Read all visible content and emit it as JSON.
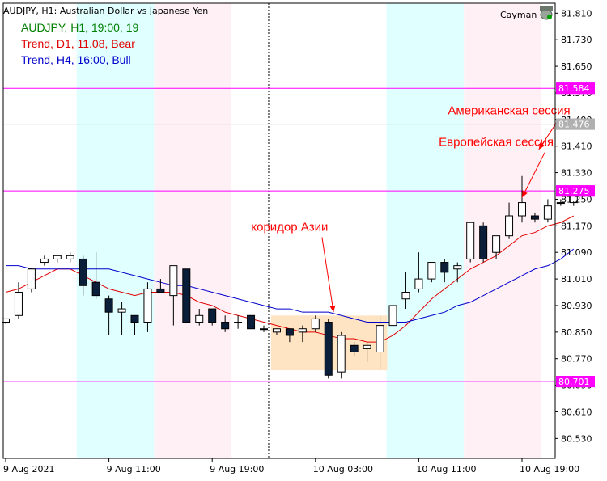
{
  "header": {
    "symbol_line": "AUDJPY, H1:  Australian Dollar vs Japanese Yen",
    "info": [
      {
        "text": "AUDJPY, H1, 19:00, 19",
        "color": "#008000"
      },
      {
        "text": "Trend, D1, 11.08, Bear",
        "color": "#e00000"
      },
      {
        "text": "Trend, H4, 16:00, Bull",
        "color": "#0000cc"
      }
    ],
    "account_label": "Cayman",
    "account_icon": "trader-hat-icon"
  },
  "chart_data": {
    "type": "candlestick",
    "timeframe": "H1",
    "symbol": "AUDJPY",
    "ylim": [
      80.47,
      81.84
    ],
    "y_ticks": [
      "81.810",
      "81.730",
      "81.650",
      "81.570",
      "81.490",
      "81.410",
      "81.330",
      "81.250",
      "81.170",
      "81.090",
      "81.010",
      "80.930",
      "80.850",
      "80.770",
      "80.690",
      "80.610",
      "80.530"
    ],
    "x_tick_labels": [
      {
        "label": "9 Aug 2021",
        "index": 0
      },
      {
        "label": "9 Aug 11:00",
        "index": 8
      },
      {
        "label": "9 Aug 19:00",
        "index": 16
      },
      {
        "label": "10 Aug 03:00",
        "index": 24
      },
      {
        "label": "10 Aug 11:00",
        "index": 32
      },
      {
        "label": "10 Aug 19:00",
        "index": 40
      }
    ],
    "price_levels": [
      {
        "value": 81.584,
        "label": "81.584",
        "color": "#ff00ff"
      },
      {
        "value": 81.476,
        "label": "81.476",
        "color": "#b0b0b0"
      },
      {
        "value": 81.275,
        "label": "81.275",
        "color": "#ff00ff"
      },
      {
        "value": 80.701,
        "label": "80.701",
        "color": "#ff00ff"
      }
    ],
    "sessions": [
      {
        "type": "asia",
        "from": 6,
        "to": 12,
        "color": "#e0ffff"
      },
      {
        "type": "europe",
        "from": 12,
        "to": 18,
        "color": "#fff0f5"
      },
      {
        "type": "asia",
        "from": 30,
        "to": 36,
        "color": "#e0ffff"
      },
      {
        "type": "europe",
        "from": 36,
        "to": 42,
        "color": "#fff0f5"
      }
    ],
    "asia_box": {
      "from": 21,
      "to": 30,
      "low": 80.735,
      "high": 80.9,
      "color": "#ffe4c4"
    },
    "period_separator_index": 21,
    "candles": [
      {
        "o": 80.88,
        "h": 80.89,
        "l": 80.875,
        "c": 80.89
      },
      {
        "o": 80.9,
        "h": 81.0,
        "l": 80.89,
        "c": 80.97
      },
      {
        "o": 80.98,
        "h": 81.04,
        "l": 80.97,
        "c": 81.04
      },
      {
        "o": 81.06,
        "h": 81.08,
        "l": 81.05,
        "c": 81.07
      },
      {
        "o": 81.07,
        "h": 81.08,
        "l": 81.06,
        "c": 81.08
      },
      {
        "o": 81.07,
        "h": 81.09,
        "l": 81.06,
        "c": 81.08
      },
      {
        "o": 81.07,
        "h": 81.08,
        "l": 80.96,
        "c": 80.99
      },
      {
        "o": 81.0,
        "h": 81.09,
        "l": 80.95,
        "c": 80.96
      },
      {
        "o": 80.95,
        "h": 80.96,
        "l": 80.84,
        "c": 80.91
      },
      {
        "o": 80.91,
        "h": 80.94,
        "l": 80.84,
        "c": 80.92
      },
      {
        "o": 80.9,
        "h": 80.9,
        "l": 80.84,
        "c": 80.88
      },
      {
        "o": 80.88,
        "h": 81.0,
        "l": 80.85,
        "c": 80.98
      },
      {
        "o": 80.98,
        "h": 81.01,
        "l": 80.97,
        "c": 80.97
      },
      {
        "o": 80.96,
        "h": 81.05,
        "l": 80.87,
        "c": 81.05
      },
      {
        "o": 81.04,
        "h": 81.04,
        "l": 80.88,
        "c": 80.88
      },
      {
        "o": 80.88,
        "h": 80.92,
        "l": 80.87,
        "c": 80.9
      },
      {
        "o": 80.92,
        "h": 80.92,
        "l": 80.87,
        "c": 80.88
      },
      {
        "o": 80.88,
        "h": 80.9,
        "l": 80.85,
        "c": 80.86
      },
      {
        "o": 80.88,
        "h": 80.9,
        "l": 80.86,
        "c": 80.88
      },
      {
        "o": 80.9,
        "h": 80.9,
        "l": 80.86,
        "c": 80.86
      },
      {
        "o": 80.86,
        "h": 80.87,
        "l": 80.85,
        "c": 80.86
      },
      {
        "o": 80.85,
        "h": 80.86,
        "l": 80.84,
        "c": 80.86
      },
      {
        "o": 80.86,
        "h": 80.86,
        "l": 80.82,
        "c": 80.84
      },
      {
        "o": 80.85,
        "h": 80.87,
        "l": 80.82,
        "c": 80.86
      },
      {
        "o": 80.86,
        "h": 80.9,
        "l": 80.85,
        "c": 80.89
      },
      {
        "o": 80.88,
        "h": 80.89,
        "l": 80.71,
        "c": 80.72
      },
      {
        "o": 80.73,
        "h": 80.85,
        "l": 80.71,
        "c": 80.84
      },
      {
        "o": 80.81,
        "h": 80.82,
        "l": 80.78,
        "c": 80.79
      },
      {
        "o": 80.8,
        "h": 80.82,
        "l": 80.76,
        "c": 80.81
      },
      {
        "o": 80.79,
        "h": 80.9,
        "l": 80.74,
        "c": 80.87
      },
      {
        "o": 80.87,
        "h": 80.93,
        "l": 80.83,
        "c": 80.93
      },
      {
        "o": 80.95,
        "h": 81.03,
        "l": 80.92,
        "c": 80.97
      },
      {
        "o": 80.98,
        "h": 81.09,
        "l": 80.97,
        "c": 81.01
      },
      {
        "o": 81.01,
        "h": 81.06,
        "l": 81.0,
        "c": 81.06
      },
      {
        "o": 81.06,
        "h": 81.07,
        "l": 81.0,
        "c": 81.03
      },
      {
        "o": 81.04,
        "h": 81.06,
        "l": 81.0,
        "c": 81.05
      },
      {
        "o": 81.07,
        "h": 81.18,
        "l": 81.06,
        "c": 81.18
      },
      {
        "o": 81.17,
        "h": 81.18,
        "l": 81.06,
        "c": 81.07
      },
      {
        "o": 81.09,
        "h": 81.14,
        "l": 81.07,
        "c": 81.14
      },
      {
        "o": 81.14,
        "h": 81.24,
        "l": 81.13,
        "c": 81.2
      },
      {
        "o": 81.2,
        "h": 81.32,
        "l": 81.18,
        "c": 81.24
      },
      {
        "o": 81.2,
        "h": 81.21,
        "l": 81.18,
        "c": 81.19
      },
      {
        "o": 81.19,
        "h": 81.25,
        "l": 81.18,
        "c": 81.23
      },
      {
        "o": 81.24,
        "h": 81.25,
        "l": 81.23,
        "c": 81.24
      },
      {
        "o": 81.24,
        "h": 81.28,
        "l": 81.23,
        "c": 81.27
      }
    ],
    "trend_d1_ma": [
      80.97,
      80.98,
      81.0,
      81.02,
      81.04,
      81.04,
      81.02,
      81.0,
      80.98,
      80.97,
      80.96,
      80.97,
      80.97,
      80.97,
      80.96,
      80.94,
      80.93,
      80.91,
      80.9,
      80.89,
      80.88,
      80.87,
      80.86,
      80.85,
      80.85,
      80.84,
      80.83,
      80.83,
      80.82,
      80.82,
      80.84,
      80.87,
      80.91,
      80.95,
      80.98,
      81.01,
      81.04,
      81.06,
      81.08,
      81.11,
      81.14,
      81.15,
      81.17,
      81.18,
      81.2
    ],
    "trend_h4_ma": [
      81.05,
      81.05,
      81.04,
      81.04,
      81.04,
      81.04,
      81.04,
      81.04,
      81.04,
      81.03,
      81.02,
      81.01,
      81.0,
      80.99,
      80.99,
      80.98,
      80.97,
      80.96,
      80.95,
      80.94,
      80.93,
      80.92,
      80.92,
      80.91,
      80.91,
      80.91,
      80.9,
      80.89,
      80.88,
      80.88,
      80.88,
      80.88,
      80.89,
      80.9,
      80.91,
      80.93,
      80.94,
      80.96,
      80.98,
      81.0,
      81.02,
      81.04,
      81.05,
      81.07,
      81.1
    ],
    "annotations": [
      {
        "text": "Американская сессия",
        "tx": 39.0,
        "ty": 81.505,
        "ax": 41.3,
        "ay": 81.4
      },
      {
        "text": "Европейская сессия",
        "tx": 38.0,
        "ty": 81.41,
        "ax": 40.0,
        "ay": 81.255
      },
      {
        "text": "коридор Азии",
        "tx": 22.0,
        "ty": 81.155,
        "ax": 25.4,
        "ay": 80.91
      }
    ]
  }
}
